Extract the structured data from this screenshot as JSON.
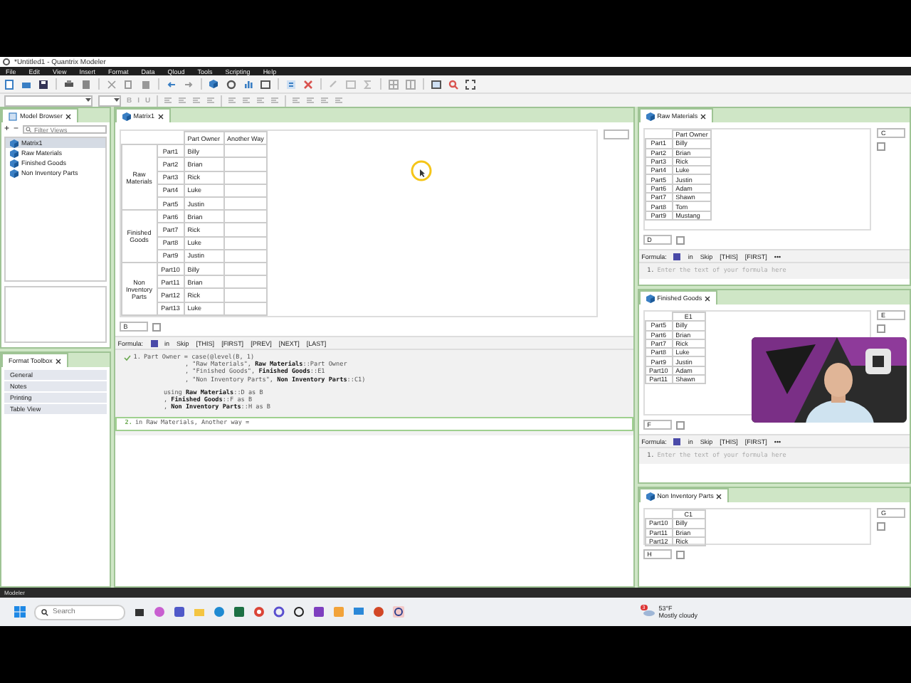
{
  "window": {
    "title": "*Untitled1 - Quantrix Modeler"
  },
  "menu": [
    "File",
    "Edit",
    "View",
    "Insert",
    "Format",
    "Data",
    "Qloud",
    "Tools",
    "Scripting",
    "Help"
  ],
  "format_bar": {
    "buttons": [
      {
        "label": "B",
        "disabled": true
      },
      {
        "label": "I",
        "disabled": true
      },
      {
        "label": "U",
        "disabled": true
      }
    ]
  },
  "model_browser": {
    "tab": "Model Browser",
    "add": "+",
    "remove": "−",
    "filter_placeholder": "Filter Views",
    "items": [
      {
        "label": "Matrix1",
        "selected": true
      },
      {
        "label": "Raw Materials",
        "selected": false
      },
      {
        "label": "Finished Goods",
        "selected": false
      },
      {
        "label": "Non Inventory Parts",
        "selected": false
      }
    ]
  },
  "format_toolbox": {
    "tab": "Format Toolbox",
    "items": [
      "General",
      "Notes",
      "Printing",
      "Table View"
    ]
  },
  "matrix": {
    "tab": "Matrix1",
    "columns": [
      "Part Owner",
      "Another Way"
    ],
    "groups": [
      {
        "label": "Raw Materials",
        "rows": [
          {
            "item": "Part1",
            "owner": "Billy"
          },
          {
            "item": "Part2",
            "owner": "Brian"
          },
          {
            "item": "Part3",
            "owner": "Rick"
          },
          {
            "item": "Part4",
            "owner": "Luke"
          },
          {
            "item": "Part5",
            "owner": "Justin"
          }
        ]
      },
      {
        "label": "Finished Goods",
        "rows": [
          {
            "item": "Part6",
            "owner": "Brian"
          },
          {
            "item": "Part7",
            "owner": "Rick"
          },
          {
            "item": "Part8",
            "owner": "Luke"
          },
          {
            "item": "Part9",
            "owner": "Justin"
          }
        ]
      },
      {
        "label": "Non Inventory Parts",
        "rows": [
          {
            "item": "Part10",
            "owner": "Billy"
          },
          {
            "item": "Part11",
            "owner": "Brian"
          },
          {
            "item": "Part12",
            "owner": "Rick"
          },
          {
            "item": "Part13",
            "owner": "Luke"
          }
        ]
      }
    ],
    "category_field": "B",
    "formula_bar": {
      "label": "Formula:",
      "items": [
        "in",
        "Skip",
        "[THIS]",
        "[FIRST]",
        "[PREV]",
        "[NEXT]",
        "[LAST]"
      ]
    },
    "formulas": [
      {
        "number": "1.",
        "valid": true,
        "editing": false,
        "lines": [
          "Part Owner = case(@level(B, 1)",
          ", \"Raw Materials\", **Raw Materials**::Part Owner",
          ", \"Finished Goods\", **Finished Goods**::E1",
          ", \"Non Inventory Parts\", **Non Inventory Parts**::C1)"
        ],
        "using": [
          "using **Raw Materials**::D as B",
          ", **Finished Goods**::F as B",
          ", **Non Inventory Parts**::H as B"
        ]
      },
      {
        "number": "2.",
        "valid": false,
        "editing": true,
        "lines": [
          "in Raw Materials, Another way ="
        ]
      }
    ]
  },
  "side_panels": [
    {
      "tab": "Raw Materials",
      "column": "Part Owner",
      "side_field": "C",
      "bottom_field": "D",
      "rows": [
        {
          "item": "Part1",
          "value": "Billy"
        },
        {
          "item": "Part2",
          "value": "Brian"
        },
        {
          "item": "Part3",
          "value": "Rick"
        },
        {
          "item": "Part4",
          "value": "Luke"
        },
        {
          "item": "Part5",
          "value": "Justin"
        },
        {
          "item": "Part6",
          "value": "Adam"
        },
        {
          "item": "Part7",
          "value": "Shawn"
        },
        {
          "item": "Part8",
          "value": "Tom"
        },
        {
          "item": "Part9",
          "value": "Mustang"
        }
      ],
      "formula": {
        "label": "Formula:",
        "items": [
          "in",
          "Skip",
          "[THIS]",
          "[FIRST]",
          "•••"
        ],
        "number": "1.",
        "placeholder": "Enter the text of your formula here"
      }
    },
    {
      "tab": "Finished Goods",
      "column": "E1",
      "side_field": "E",
      "bottom_field": "F",
      "rows": [
        {
          "item": "Part5",
          "value": "Billy"
        },
        {
          "item": "Part6",
          "value": "Brian"
        },
        {
          "item": "Part7",
          "value": "Rick"
        },
        {
          "item": "Part8",
          "value": "Luke"
        },
        {
          "item": "Part9",
          "value": "Justin"
        },
        {
          "item": "Part10",
          "value": "Adam"
        },
        {
          "item": "Part11",
          "value": "Shawn"
        }
      ],
      "formula": {
        "label": "Formula:",
        "items": [
          "in",
          "Skip",
          "[THIS]",
          "[FIRST]",
          "•••"
        ],
        "number": "1.",
        "placeholder": "Enter the text of your formula here"
      }
    },
    {
      "tab": "Non Inventory Parts",
      "column": "C1",
      "side_field": "G",
      "bottom_field": "H",
      "rows": [
        {
          "item": "Part10",
          "value": "Billy"
        },
        {
          "item": "Part11",
          "value": "Brian"
        },
        {
          "item": "Part12",
          "value": "Rick"
        }
      ]
    }
  ],
  "status_bar": "Modeler",
  "taskbar": {
    "search_placeholder": "Search",
    "weather": {
      "badge": "3",
      "temperature": "53°F",
      "condition": "Mostly cloudy"
    }
  }
}
